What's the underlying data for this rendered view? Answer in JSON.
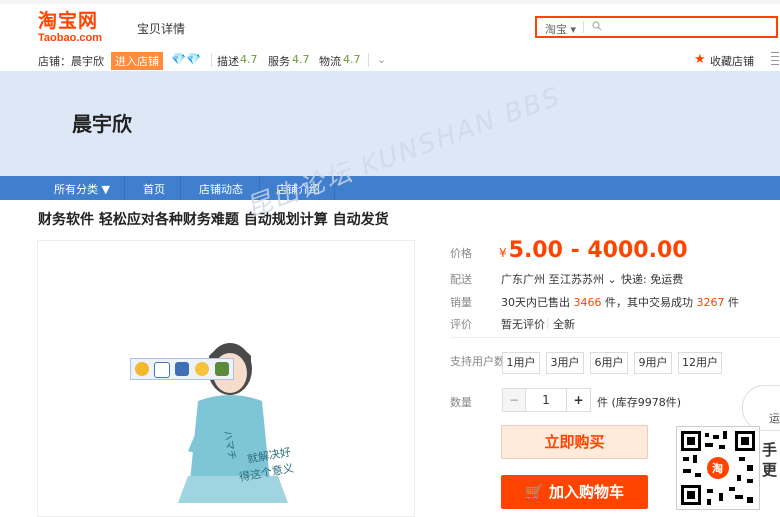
{
  "header": {
    "logo_cn": "淘宝网",
    "logo_en": "Taobao.com",
    "sub_title": "宝贝详情",
    "search": {
      "scope": "淘宝",
      "placeholder": ""
    }
  },
  "shop": {
    "label": "店铺：",
    "name": "晨宇欣",
    "enter_label": "进入店铺",
    "desc_label": "描述",
    "desc_score": "4.7",
    "service_label": "服务",
    "service_score": "4.7",
    "logistics_label": "物流",
    "logistics_score": "4.7",
    "favorite_label": "收藏店铺"
  },
  "banner": {
    "shop_name": "晨宇欣"
  },
  "nav": {
    "items": [
      "所有分类",
      "首页",
      "店铺动态",
      "店铺介绍"
    ]
  },
  "product": {
    "title": "财务软件 轻松应对各种财务难题 自动规划计算 自动发货",
    "price_label": "价格",
    "currency": "¥",
    "price": "5.00 - 4000.00",
    "delivery_label": "配送",
    "delivery_from": "广东广州 至",
    "delivery_to": "江苏苏州",
    "delivery_fee": "快递: 免运费",
    "sales_label": "销量",
    "sales_prefix": "30天内已售出",
    "sales_count": "3466",
    "sales_mid": "件，其中交易成功",
    "sales_success": "3267",
    "sales_unit": "件",
    "review_label": "评价",
    "review_text": "暂无评价",
    "condition": "全新",
    "users_label": "支持用户数",
    "user_options": [
      "1用户",
      "3用户",
      "6用户",
      "9用户",
      "12用户"
    ],
    "qty_label": "数量",
    "qty_minus": "−",
    "qty_value": "1",
    "qty_plus": "+",
    "stock_text": "件 (库存9978件)",
    "buy_label": "立即购买",
    "cart_label": "加入购物车"
  },
  "image_toolbar": {
    "icons": [
      "smiley-icon",
      "save-icon",
      "monitor-icon",
      "heart-icon",
      "image-icon"
    ]
  },
  "watermark": "昆山论坛 KUNSHAN BBS",
  "side": {
    "qr_label": "淘",
    "side_text_1": "手",
    "side_text_2": "更",
    "float_text": "运"
  },
  "colors": {
    "brand": "#ff4400",
    "nav": "#3f7fce",
    "banner": "#dde8f7",
    "score": "#6c9c35"
  }
}
